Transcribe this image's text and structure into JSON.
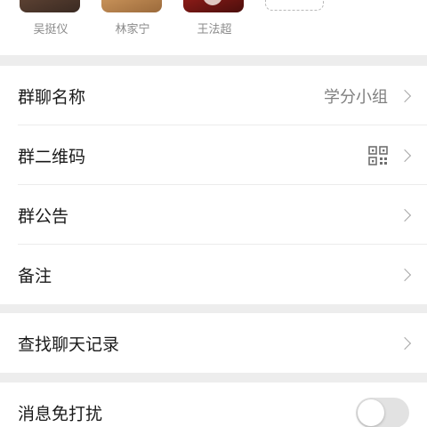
{
  "members": [
    {
      "name": "吴挺仪"
    },
    {
      "name": "林家宁"
    },
    {
      "name": "王法超"
    }
  ],
  "add_member_icon": "add-member-icon",
  "group_name": {
    "label": "群聊名称",
    "value": "学分小组"
  },
  "group_qr": {
    "label": "群二维码",
    "icon": "qr-code-icon"
  },
  "group_notice": {
    "label": "群公告"
  },
  "remark": {
    "label": "备注"
  },
  "search_history": {
    "label": "查找聊天记录"
  },
  "do_not_disturb": {
    "label": "消息免打扰",
    "enabled": false
  },
  "colors": {
    "background": "#ededed",
    "row_background": "#ffffff",
    "text_primary": "#1a1a1a",
    "text_secondary": "#7f7f7f",
    "toggle_off": "#e2e2e2"
  }
}
